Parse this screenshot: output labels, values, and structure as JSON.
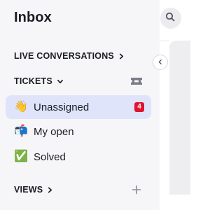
{
  "header": {
    "title": "Inbox"
  },
  "sections": {
    "live": {
      "label": "LIVE CONVERSATIONS"
    },
    "tickets": {
      "label": "TICKETS",
      "items": [
        {
          "label": "Unassigned",
          "emoji": "👋",
          "badge": "4",
          "active": true
        },
        {
          "label": "My open",
          "emoji": "📬",
          "active": false
        },
        {
          "label": "Solved",
          "emoji": "✅",
          "active": false
        }
      ]
    },
    "views": {
      "label": "VIEWS"
    }
  },
  "icons": {
    "search": "search-icon",
    "collapse": "chevron-left-icon",
    "ticket": "ticket-icon",
    "add": "plus-icon"
  },
  "colors": {
    "sidebar_bg": "#f6f6f8",
    "active_bg": "#dfe4fa",
    "badge_bg": "#e0142f",
    "text": "#1b1d24"
  }
}
